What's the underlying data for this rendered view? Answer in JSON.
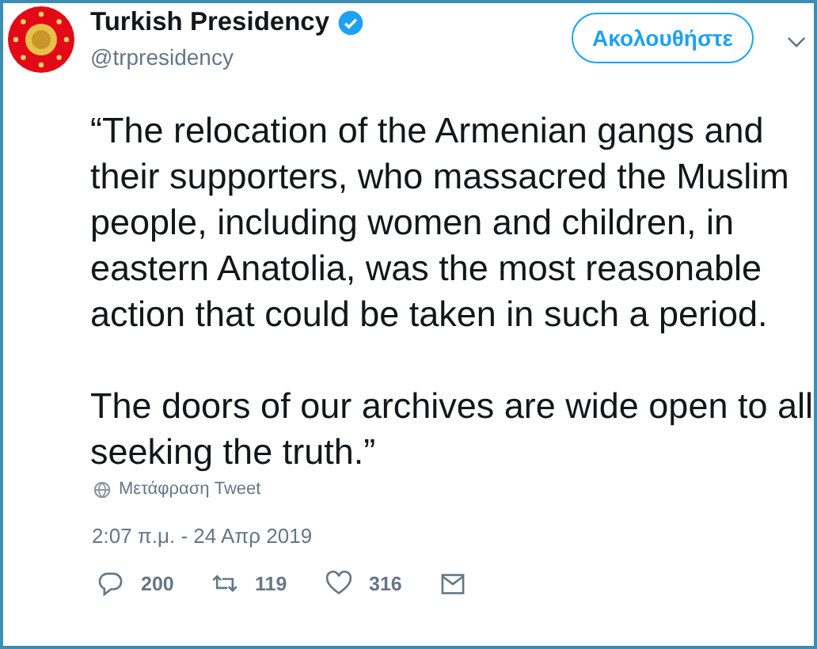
{
  "account": {
    "name": "Turkish Presidency",
    "verified": true,
    "handle": "@trpresidency"
  },
  "follow_button": {
    "label": "Ακολουθήστε"
  },
  "tweet": {
    "paragraphs": [
      "“The relocation of the Armenian gangs and their supporters, who massacred the Muslim people, including women and children, in eastern Anatolia, was the most reasonable action that could be taken in such a period.",
      "The doors of our archives are wide open to all seeking the truth.”"
    ],
    "translate": "Μετάφραση Tweet",
    "timestamp": "2:07 π.μ. - 24 Απρ 2019"
  },
  "actions": [
    {
      "kind": "reply",
      "count": "200"
    },
    {
      "kind": "retweet",
      "count": "119"
    },
    {
      "kind": "like",
      "count": "316"
    },
    {
      "kind": "message"
    }
  ]
}
